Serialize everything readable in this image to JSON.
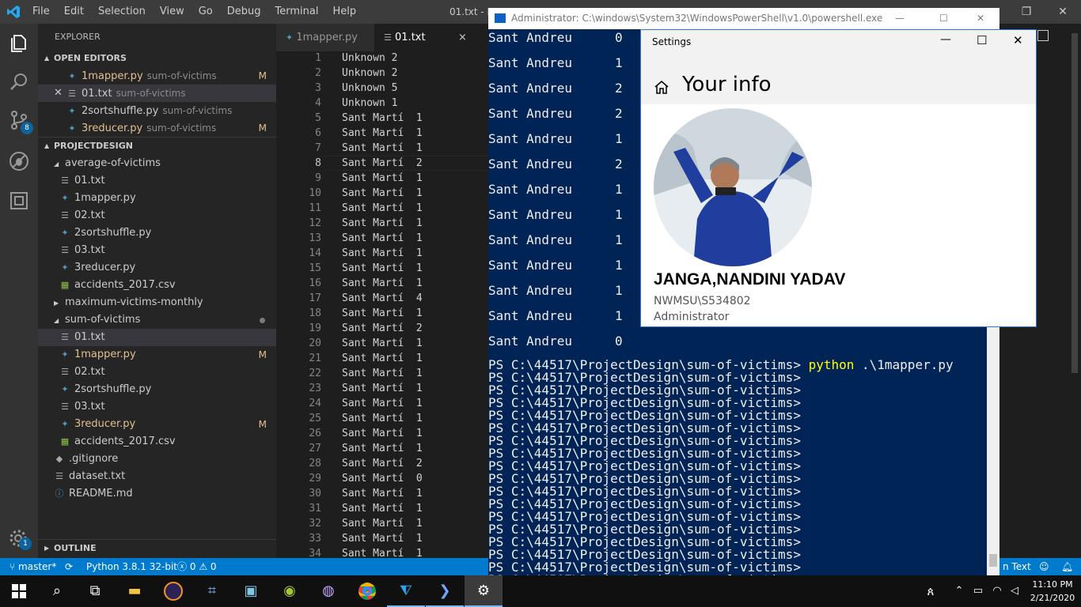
{
  "vscode": {
    "menu": [
      "File",
      "Edit",
      "Selection",
      "View",
      "Go",
      "Debug",
      "Terminal",
      "Help"
    ],
    "window_title": "01.txt - P",
    "sidebar": {
      "explorer_label": "EXPLORER",
      "open_editors_label": "OPEN EDITORS",
      "open_editors": [
        {
          "name": "1mapper.py",
          "folder": "sum-of-victims",
          "icon": "python-file-icon",
          "modified": "M"
        },
        {
          "name": "01.txt",
          "folder": "sum-of-victims",
          "icon": "text-file-icon",
          "modified": "",
          "close": "✕"
        },
        {
          "name": "2sortshuffle.py",
          "folder": "sum-of-victims",
          "icon": "python-file-icon",
          "modified": ""
        },
        {
          "name": "3reducer.py",
          "folder": "sum-of-victims",
          "icon": "python-file-icon",
          "modified": "M"
        }
      ],
      "project_label": "PROJECTDESIGN",
      "tree": [
        {
          "name": "average-of-victims",
          "kind": "folder-open",
          "indent": 1
        },
        {
          "name": "01.txt",
          "kind": "txt",
          "indent": 2
        },
        {
          "name": "1mapper.py",
          "kind": "py",
          "indent": 2
        },
        {
          "name": "02.txt",
          "kind": "txt",
          "indent": 2
        },
        {
          "name": "2sortshuffle.py",
          "kind": "py",
          "indent": 2
        },
        {
          "name": "03.txt",
          "kind": "txt",
          "indent": 2
        },
        {
          "name": "3reducer.py",
          "kind": "py",
          "indent": 2
        },
        {
          "name": "accidents_2017.csv",
          "kind": "csv",
          "indent": 2
        },
        {
          "name": "maximum-victims-monthly",
          "kind": "folder-closed",
          "indent": 1
        },
        {
          "name": "sum-of-victims",
          "kind": "folder-open",
          "indent": 1,
          "dot": true
        },
        {
          "name": "01.txt",
          "kind": "txt",
          "indent": 2,
          "selected": true
        },
        {
          "name": "1mapper.py",
          "kind": "py",
          "indent": 2,
          "modified": "M"
        },
        {
          "name": "02.txt",
          "kind": "txt",
          "indent": 2
        },
        {
          "name": "2sortshuffle.py",
          "kind": "py",
          "indent": 2
        },
        {
          "name": "03.txt",
          "kind": "txt",
          "indent": 2
        },
        {
          "name": "3reducer.py",
          "kind": "py",
          "indent": 2,
          "modified": "M"
        },
        {
          "name": "accidents_2017.csv",
          "kind": "csv",
          "indent": 2
        },
        {
          "name": ".gitignore",
          "kind": "git",
          "indent": 1
        },
        {
          "name": "dataset.txt",
          "kind": "txt",
          "indent": 1
        },
        {
          "name": "README.md",
          "kind": "info",
          "indent": 1
        }
      ],
      "outline_label": "OUTLINE"
    },
    "activity_badges": {
      "scm": "8",
      "settings": "1"
    },
    "tabs": [
      {
        "label": "1mapper.py",
        "active": false
      },
      {
        "label": "01.txt",
        "active": true,
        "close": "×"
      }
    ],
    "editor_lines": [
      "Unknown 2",
      "Unknown 2",
      "Unknown 5",
      "Unknown 1",
      "Sant Martí  1",
      "Sant Martí  1",
      "Sant Martí  1",
      "Sant Martí  2",
      "Sant Martí  1",
      "Sant Martí  1",
      "Sant Martí  1",
      "Sant Martí  1",
      "Sant Martí  1",
      "Sant Martí  1",
      "Sant Martí  1",
      "Sant Martí  1",
      "Sant Martí  4",
      "Sant Martí  1",
      "Sant Martí  2",
      "Sant Martí  1",
      "Sant Martí  1",
      "Sant Martí  1",
      "Sant Martí  1",
      "Sant Martí  1",
      "Sant Martí  1",
      "Sant Martí  1",
      "Sant Martí  1",
      "Sant Martí  2",
      "Sant Martí  0",
      "Sant Martí  1",
      "Sant Martí  1",
      "Sant Martí  1",
      "Sant Martí  1",
      "Sant Martí  1"
    ],
    "current_line": 8,
    "status": {
      "branch": "master*",
      "python": "Python 3.8.1 32-bit",
      "errors": "0",
      "warnings": "0",
      "right_text": "n Text"
    }
  },
  "powershell": {
    "title": "Administrator: C:\\windows\\System32\\WindowsPowerShell\\v1.0\\powershell.exe",
    "output_rows": [
      [
        "Sant Andreu",
        "0"
      ],
      [
        "Sant Andreu",
        "1"
      ],
      [
        "Sant Andreu",
        "2"
      ],
      [
        "Sant Andreu",
        "2"
      ],
      [
        "Sant Andreu",
        "1"
      ],
      [
        "Sant Andreu",
        "2"
      ],
      [
        "Sant Andreu",
        "1"
      ],
      [
        "Sant Andreu",
        "1"
      ],
      [
        "Sant Andreu",
        "1"
      ],
      [
        "Sant Andreu",
        "1"
      ],
      [
        "Sant Andreu",
        "1"
      ],
      [
        "Sant Andreu",
        "1"
      ],
      [
        "Sant Andreu",
        "0"
      ]
    ],
    "prompt": "PS C:\\44517\\ProjectDesign\\sum-of-victims>",
    "command": "python",
    "command_arg": ".\\1mapper.py",
    "empty_prompts": 17
  },
  "settings": {
    "window_title": "Settings",
    "page_title": "Your info",
    "user_name": "JANGA,NANDINI YADAV",
    "account": "NWMSU\\S534802",
    "role": "Administrator"
  },
  "taskbar": {
    "time": "11:10 PM",
    "date": "2/21/2020"
  },
  "colors": {
    "vscode_status": "#007acc",
    "powershell_bg": "#012456",
    "accent": "#0078d7"
  }
}
